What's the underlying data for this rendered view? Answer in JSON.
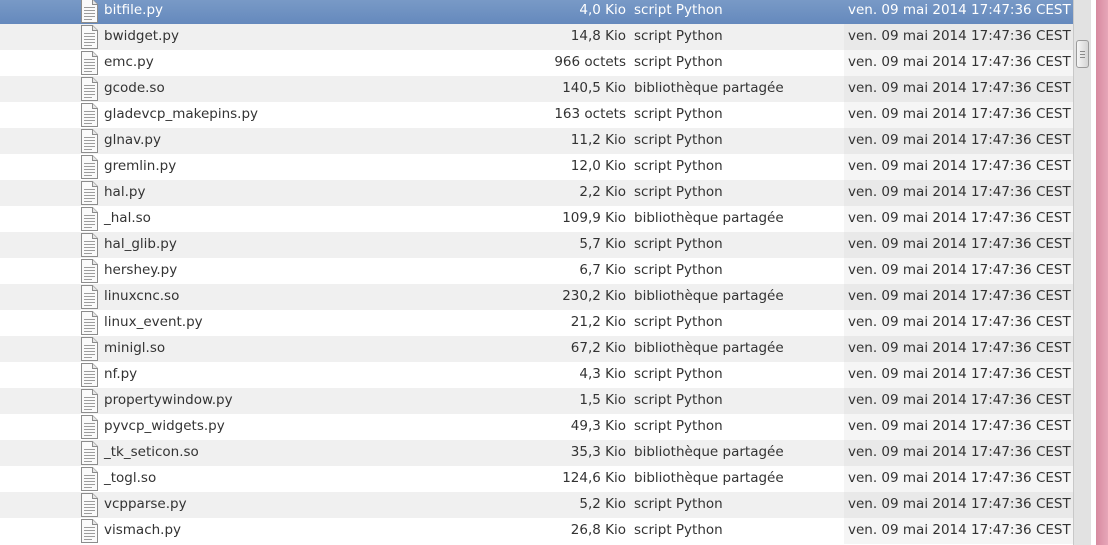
{
  "file_list": {
    "selected_index": 0,
    "rows": [
      {
        "name": "bitfile.py",
        "size": "4,0 Kio",
        "type": "script Python",
        "date": "ven. 09 mai 2014 17:47:36 CEST"
      },
      {
        "name": "bwidget.py",
        "size": "14,8 Kio",
        "type": "script Python",
        "date": "ven. 09 mai 2014 17:47:36 CEST"
      },
      {
        "name": "emc.py",
        "size": "966 octets",
        "type": "script Python",
        "date": "ven. 09 mai 2014 17:47:36 CEST"
      },
      {
        "name": "gcode.so",
        "size": "140,5 Kio",
        "type": "bibliothèque partagée",
        "date": "ven. 09 mai 2014 17:47:36 CEST"
      },
      {
        "name": "gladevcp_makepins.py",
        "size": "163 octets",
        "type": "script Python",
        "date": "ven. 09 mai 2014 17:47:36 CEST"
      },
      {
        "name": "glnav.py",
        "size": "11,2 Kio",
        "type": "script Python",
        "date": "ven. 09 mai 2014 17:47:36 CEST"
      },
      {
        "name": "gremlin.py",
        "size": "12,0 Kio",
        "type": "script Python",
        "date": "ven. 09 mai 2014 17:47:36 CEST"
      },
      {
        "name": "hal.py",
        "size": "2,2 Kio",
        "type": "script Python",
        "date": "ven. 09 mai 2014 17:47:36 CEST"
      },
      {
        "name": "_hal.so",
        "size": "109,9 Kio",
        "type": "bibliothèque partagée",
        "date": "ven. 09 mai 2014 17:47:36 CEST"
      },
      {
        "name": "hal_glib.py",
        "size": "5,7 Kio",
        "type": "script Python",
        "date": "ven. 09 mai 2014 17:47:36 CEST"
      },
      {
        "name": "hershey.py",
        "size": "6,7 Kio",
        "type": "script Python",
        "date": "ven. 09 mai 2014 17:47:36 CEST"
      },
      {
        "name": "linuxcnc.so",
        "size": "230,2 Kio",
        "type": "bibliothèque partagée",
        "date": "ven. 09 mai 2014 17:47:36 CEST"
      },
      {
        "name": "linux_event.py",
        "size": "21,2 Kio",
        "type": "script Python",
        "date": "ven. 09 mai 2014 17:47:36 CEST"
      },
      {
        "name": "minigl.so",
        "size": "67,2 Kio",
        "type": "bibliothèque partagée",
        "date": "ven. 09 mai 2014 17:47:36 CEST"
      },
      {
        "name": "nf.py",
        "size": "4,3 Kio",
        "type": "script Python",
        "date": "ven. 09 mai 2014 17:47:36 CEST"
      },
      {
        "name": "propertywindow.py",
        "size": "1,5 Kio",
        "type": "script Python",
        "date": "ven. 09 mai 2014 17:47:36 CEST"
      },
      {
        "name": "pyvcp_widgets.py",
        "size": "49,3 Kio",
        "type": "script Python",
        "date": "ven. 09 mai 2014 17:47:36 CEST"
      },
      {
        "name": "_tk_seticon.so",
        "size": "35,3 Kio",
        "type": "bibliothèque partagée",
        "date": "ven. 09 mai 2014 17:47:36 CEST"
      },
      {
        "name": "_togl.so",
        "size": "124,6 Kio",
        "type": "bibliothèque partagée",
        "date": "ven. 09 mai 2014 17:47:36 CEST"
      },
      {
        "name": "vcpparse.py",
        "size": "5,2 Kio",
        "type": "script Python",
        "date": "ven. 09 mai 2014 17:47:36 CEST"
      },
      {
        "name": "vismach.py",
        "size": "26,8 Kio",
        "type": "script Python",
        "date": "ven. 09 mai 2014 17:47:36 CEST"
      }
    ]
  },
  "icons": {
    "file_icon": "text-document-icon",
    "scroll_grip": "grip-lines-icon"
  }
}
